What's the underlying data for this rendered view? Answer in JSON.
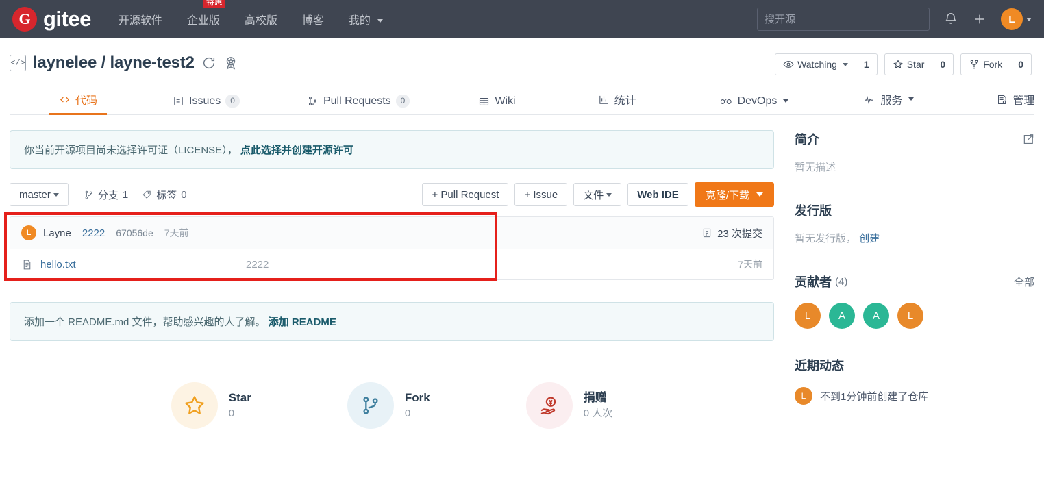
{
  "topbar": {
    "logo_letter": "G",
    "logo_text": "gitee",
    "nav": [
      {
        "label": "开源软件",
        "caret": false,
        "badge": null
      },
      {
        "label": "企业版",
        "caret": false,
        "badge": "特惠"
      },
      {
        "label": "高校版",
        "caret": false,
        "badge": null
      },
      {
        "label": "博客",
        "caret": false,
        "badge": null
      },
      {
        "label": "我的",
        "caret": true,
        "badge": null
      }
    ],
    "search_placeholder": "搜开源",
    "search_value": "",
    "bell_icon": "bell-icon",
    "plus_icon": "plus-icon",
    "avatar_letter": "L"
  },
  "repo": {
    "owner": "laynelee",
    "separator": "/",
    "name": "layne-test2",
    "full_title": "laynelee / layne-test2",
    "code_icon": "</>",
    "sync_icon": "sync-icon",
    "badge_icon": "award-icon",
    "watch_label": "Watching",
    "watch_count": "1",
    "star_label": "Star",
    "star_count": "0",
    "fork_label": "Fork",
    "fork_count": "0"
  },
  "tabs": [
    {
      "label": "代码",
      "count": null,
      "active": true,
      "caret": false,
      "icon": "code-icon"
    },
    {
      "label": "Issues",
      "count": "0",
      "active": false,
      "caret": false,
      "icon": "issue-icon"
    },
    {
      "label": "Pull Requests",
      "count": "0",
      "active": false,
      "caret": false,
      "icon": "pr-icon"
    },
    {
      "label": "Wiki",
      "count": null,
      "active": false,
      "caret": false,
      "icon": "wiki-icon"
    },
    {
      "label": "统计",
      "count": null,
      "active": false,
      "caret": false,
      "icon": "chart-icon"
    },
    {
      "label": "DevOps",
      "count": null,
      "active": false,
      "caret": true,
      "icon": "infinity-icon"
    },
    {
      "label": "服务",
      "count": null,
      "active": false,
      "caret": true,
      "icon": "pulse-icon"
    },
    {
      "label": "管理",
      "count": null,
      "active": false,
      "caret": false,
      "icon": "manage-icon"
    }
  ],
  "license_notice": {
    "text": "你当前开源项目尚未选择许可证（LICENSE），",
    "link": "点此选择并创建开源许可"
  },
  "toolbar": {
    "branch_name": "master",
    "branches_label": "分支",
    "branches_count": "1",
    "tags_label": "标签",
    "tags_count": "0",
    "pull_request_btn": "+ Pull Request",
    "issue_btn": "+ Issue",
    "files_btn": "文件",
    "webide_btn": "Web IDE",
    "clone_btn": "克隆/下载"
  },
  "commit": {
    "avatar_letter": "L",
    "author": "Layne",
    "message": "2222",
    "sha": "67056de",
    "time": "7天前",
    "commits_count": "23 次提交"
  },
  "files": [
    {
      "icon": "file-icon",
      "name": "hello.txt",
      "message": "2222",
      "time": "7天前"
    }
  ],
  "readme_notice": {
    "text": "添加一个 README.md 文件，帮助感兴趣的人了解。",
    "link": "添加 README"
  },
  "stats": [
    {
      "label": "Star",
      "value": "0",
      "icon": "star-icon",
      "circle_color": "#fdf3e3",
      "icon_color": "#f0a020"
    },
    {
      "label": "Fork",
      "value": "0",
      "icon": "fork-icon",
      "circle_color": "#e8f2f7",
      "icon_color": "#3e7f9e"
    },
    {
      "label": "捐赠",
      "value": "0 人次",
      "icon": "donate-icon",
      "circle_color": "#fbeef0",
      "icon_color": "#c0392b"
    }
  ],
  "sidebar": {
    "intro_title": "简介",
    "intro_edit_icon": "edit-icon",
    "intro_desc": "暂无描述",
    "release_title": "发行版",
    "release_desc": "暂无发行版，",
    "release_link": "创建",
    "contributors_title": "贡献者",
    "contributors_count": "(4)",
    "contributors_all": "全部",
    "contributors": [
      {
        "letter": "L",
        "color": "#e8892a"
      },
      {
        "letter": "A",
        "color": "#2bb795"
      },
      {
        "letter": "A",
        "color": "#2bb795"
      },
      {
        "letter": "L",
        "color": "#e8892a"
      }
    ],
    "activity_title": "近期动态",
    "activity_avatar": "L",
    "activity_text": "不到1分钟前创建了仓库"
  },
  "colors": {
    "header_bg": "#3f4551",
    "accent_orange": "#e8741c",
    "primary_orange": "#f07818",
    "annotation_red": "#e5201b",
    "link_blue": "#3a6f9c"
  }
}
